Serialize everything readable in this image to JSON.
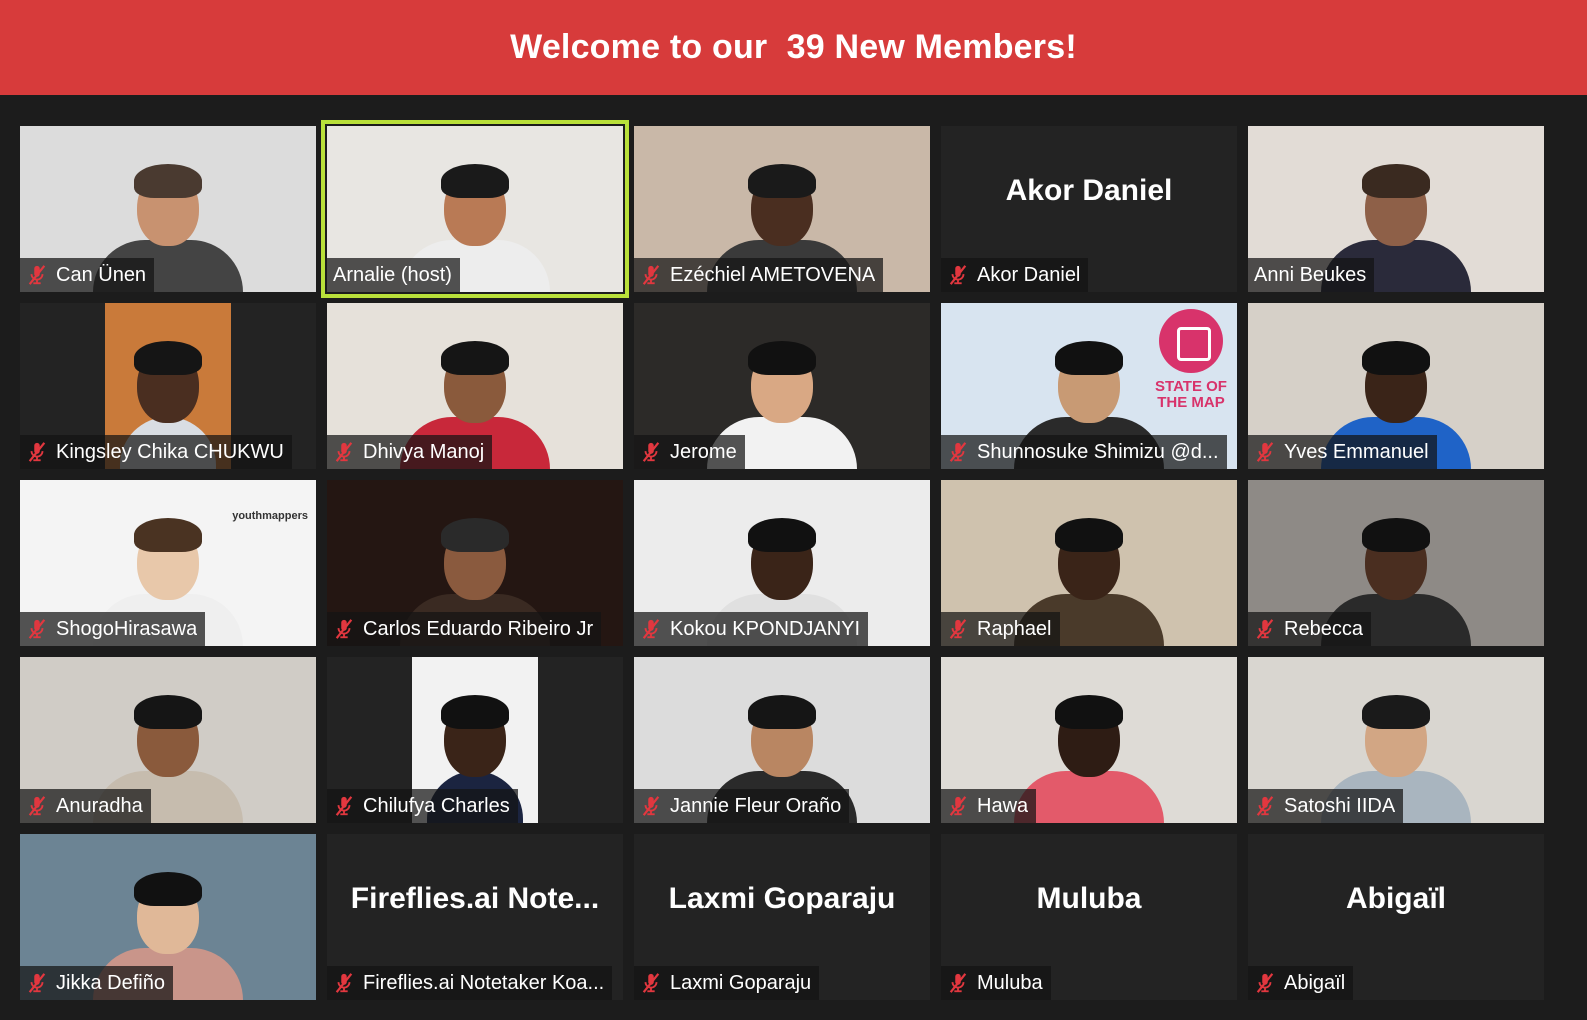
{
  "banner": {
    "title": "Welcome to our  39 New Members!"
  },
  "tiles": [
    {
      "name": "Can Ünen",
      "muted": true,
      "kind": "video",
      "bg": "#dcdcdc",
      "skin": "#c89270",
      "shirt": "#444444",
      "hair": "#4a3a30"
    },
    {
      "name": "Arnalie (host)",
      "muted": false,
      "active": true,
      "kind": "video",
      "bg": "#e8e6e2",
      "skin": "#b97a55",
      "shirt": "#ededed",
      "hair": "#1a1a1a"
    },
    {
      "name": "Ezéchiel AMETOVENA",
      "muted": true,
      "kind": "video",
      "bg": "#c9b8a8",
      "skin": "#4a2e20",
      "shirt": "#3a3a3a",
      "hair": "#1a1a1a"
    },
    {
      "name": "Akor Daniel",
      "muted": true,
      "kind": "name",
      "big": "Akor Daniel"
    },
    {
      "name": "Anni Beukes",
      "muted": false,
      "kind": "video",
      "bg": "#e2dcd6",
      "skin": "#8e6048",
      "shirt": "#2a2a3a",
      "hair": "#3a2a20"
    },
    {
      "name": "Kingsley Chika CHUKWU",
      "muted": true,
      "kind": "video",
      "pillar": true,
      "bg": "#c97a3a",
      "skin": "#4a2e20",
      "shirt": "#d9dde3",
      "hair": "#151515"
    },
    {
      "name": "Dhivya Manoj",
      "muted": true,
      "kind": "video",
      "bg": "#e6e1da",
      "skin": "#8a5a3c",
      "shirt": "#c8283a",
      "hair": "#151515"
    },
    {
      "name": "Jerome",
      "muted": true,
      "kind": "video",
      "bg": "#2c2a28",
      "skin": "#d9a884",
      "shirt": "#f2f2f2",
      "hair": "#111111"
    },
    {
      "name": "Shunnosuke Shimizu @d...",
      "muted": true,
      "kind": "video",
      "bg": "#d8e4f0",
      "skin": "#c89a74",
      "shirt": "#2a2a2a",
      "hair": "#111111",
      "sotm": "STATE OF THE MAP"
    },
    {
      "name": "Yves Emmanuel",
      "muted": true,
      "kind": "video",
      "bg": "#d6d0c8",
      "skin": "#3a2418",
      "shirt": "#1f63c7",
      "hair": "#111111"
    },
    {
      "name": "ShogoHirasawa",
      "muted": true,
      "kind": "video",
      "bg": "#f4f4f4",
      "skin": "#e8c8aa",
      "shirt": "#efefef",
      "hair": "#4a3322",
      "logo": "youthmappers"
    },
    {
      "name": "Carlos Eduardo Ribeiro Jr",
      "muted": true,
      "kind": "video",
      "bg": "#241612",
      "skin": "#8a5a3e",
      "shirt": "#3a2a22",
      "hair": "#2a2a2a"
    },
    {
      "name": "Kokou KPONDJANYI",
      "muted": true,
      "kind": "video",
      "bg": "#ececec",
      "skin": "#3a2418",
      "shirt": "#e0e0e0",
      "hair": "#111111"
    },
    {
      "name": "Raphael",
      "muted": true,
      "kind": "video",
      "bg": "#cfc2ae",
      "skin": "#3a2418",
      "shirt": "#4a3a2a",
      "hair": "#111111"
    },
    {
      "name": "Rebecca",
      "muted": true,
      "kind": "video",
      "bg": "#8e8a86",
      "skin": "#4a2e20",
      "shirt": "#2a2a2a",
      "hair": "#111111"
    },
    {
      "name": "Anuradha",
      "muted": true,
      "kind": "video",
      "bg": "#d0ccc6",
      "skin": "#8a5a3c",
      "shirt": "#c6bcae",
      "hair": "#151515"
    },
    {
      "name": "Chilufya Charles",
      "muted": true,
      "kind": "video",
      "pillar": true,
      "bg": "#f2f2f2",
      "skin": "#3a2418",
      "shirt": "#1b2440",
      "hair": "#111111"
    },
    {
      "name": "Jannie Fleur Oraño",
      "muted": true,
      "kind": "video",
      "bg": "#dcdcdc",
      "skin": "#b98662",
      "shirt": "#2a2a2a",
      "hair": "#151515"
    },
    {
      "name": "Hawa",
      "muted": true,
      "kind": "video",
      "bg": "#dedbd6",
      "skin": "#2e1c14",
      "shirt": "#e35a6a",
      "hair": "#111111"
    },
    {
      "name": "Satoshi IIDA",
      "muted": true,
      "kind": "video",
      "bg": "#d9d6d0",
      "skin": "#d2a684",
      "shirt": "#a9b5bf",
      "hair": "#1a1a1a"
    },
    {
      "name": "Jikka Defiño",
      "muted": true,
      "kind": "video",
      "bg": "#6c8494",
      "skin": "#e0b898",
      "shirt": "#c9958a",
      "hair": "#111111"
    },
    {
      "name": "Fireflies.ai Notetaker Koa...",
      "muted": true,
      "kind": "name",
      "big": "Fireflies.ai  Note..."
    },
    {
      "name": "Laxmi Goparaju",
      "muted": true,
      "kind": "name",
      "big": "Laxmi Goparaju"
    },
    {
      "name": "Muluba",
      "muted": true,
      "kind": "name",
      "big": "Muluba"
    },
    {
      "name": "Abigaïl",
      "muted": true,
      "kind": "name",
      "big": "Abigaïl"
    }
  ],
  "colors": {
    "banner": "#d73b3b",
    "active_border": "#b9e03a",
    "mute_icon": "#e2373f",
    "tile_bg": "#232323"
  }
}
